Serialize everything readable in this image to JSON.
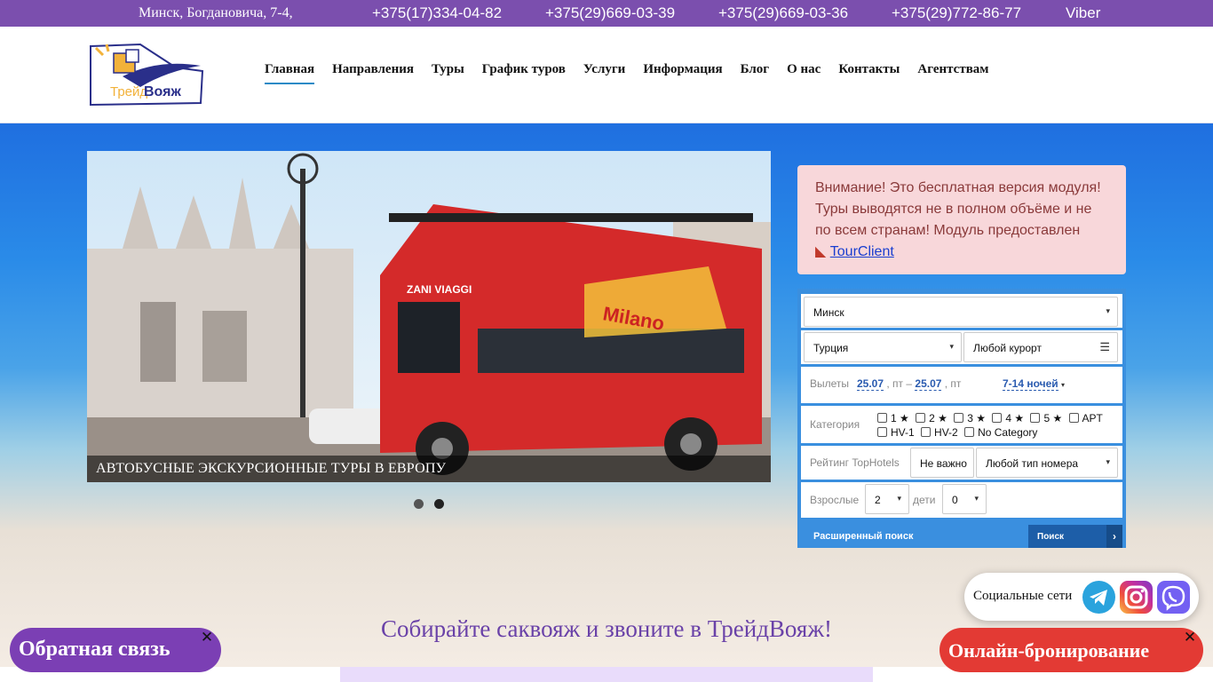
{
  "topbar": {
    "address": "Минск, Богдановича, 7-4,",
    "phone1": "+375(17)334-04-82",
    "phone2": "+375(29)669-03-39",
    "phone3": "+375(29)669-03-36",
    "phone4": "+375(29)772-86-77",
    "viber": "Viber"
  },
  "logo": {
    "brand_a": "Трейд",
    "brand_b": "Вояж"
  },
  "nav": {
    "items": [
      {
        "label": "Главная"
      },
      {
        "label": "Направления"
      },
      {
        "label": "Туры"
      },
      {
        "label": "График туров"
      },
      {
        "label": "Услуги"
      },
      {
        "label": "Информация"
      },
      {
        "label": "Блог"
      },
      {
        "label": "О нас"
      },
      {
        "label": "Контакты"
      },
      {
        "label": "Агентствам"
      }
    ]
  },
  "slider": {
    "caption": "АВТОБУСНЫЕ ЭКСКУРСИОННЫЕ ТУРЫ В ЕВРОПУ",
    "bus_text": "Milano",
    "bus_brand": "ZANI VIAGGI"
  },
  "notice": {
    "text": "Внимание! Это бесплатная версия модуля! Туры выводятся не в полном объёме и не по всем странам! Модуль предоставлен",
    "link": "TourClient"
  },
  "search": {
    "city": "Минск",
    "country": "Турция",
    "resort": "Любой курорт",
    "departures_label": "Вылеты",
    "date_from": "25.07",
    "date_sep": ", пт –",
    "date_to": "25.07",
    "date_tail": ", пт",
    "nights": "7-14 ночей",
    "category_label": "Категория",
    "categories": [
      "1 ★",
      "2 ★",
      "3 ★",
      "4 ★",
      "5 ★",
      "APT",
      "HV-1",
      "HV-2",
      "No Category"
    ],
    "rating_label": "Рейтинг TopHotels",
    "rating_value": "Не важно",
    "room_type": "Любой тип номера",
    "adults_label": "Взрослые",
    "adults": "2",
    "children_label": "дети",
    "children": "0",
    "advanced": "Расширенный поиск",
    "submit": "Поиск"
  },
  "slogan": "Собирайте саквояж и звоните в ТрейдВояж!",
  "social": {
    "label": "Социальные сети"
  },
  "feedback": {
    "label": "Обратная связь"
  },
  "booking": {
    "label": "Онлайн-бронирование"
  },
  "colors": {
    "topbar": "#7b4fae",
    "feedback": "#7b3fb4",
    "booking": "#e33a34"
  }
}
